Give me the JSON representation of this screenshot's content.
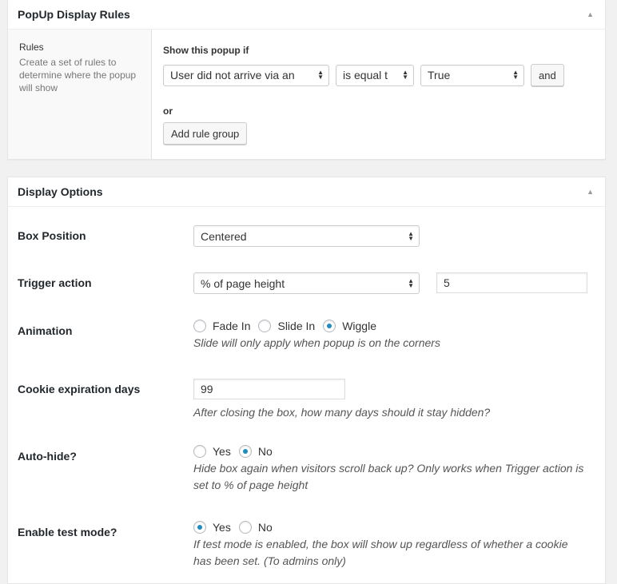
{
  "popup_rules": {
    "title": "PopUp Display Rules",
    "side_label": "Rules",
    "side_description": "Create a set of rules to determine where the popup will show",
    "show_if_label": "Show this popup if",
    "param_value": "User did not arrive via an",
    "operator_value": "is equal t",
    "value_value": "True",
    "and_label": "and",
    "or_label": "or",
    "add_group_label": "Add rule group"
  },
  "display_options": {
    "title": "Display Options",
    "box_position": {
      "label": "Box Position",
      "value": "Centered"
    },
    "trigger_action": {
      "label": "Trigger action",
      "value": "% of page height",
      "amount": "5"
    },
    "animation": {
      "label": "Animation",
      "options": [
        "Fade In",
        "Slide In",
        "Wiggle"
      ],
      "selected": "Wiggle",
      "hint": "Slide will only apply when popup is on the corners"
    },
    "cookie_expiration": {
      "label": "Cookie expiration days",
      "value": "99",
      "hint": "After closing the box, how many days should it stay hidden?"
    },
    "auto_hide": {
      "label": "Auto-hide?",
      "options": [
        "Yes",
        "No"
      ],
      "selected": "No",
      "hint_line1": "Hide box again when visitors scroll back up? Only works when Trigger action is",
      "hint_line2": "set to % of page height"
    },
    "test_mode": {
      "label": "Enable test mode?",
      "options": [
        "Yes",
        "No"
      ],
      "selected": "Yes",
      "hint_line1": "If test mode is enabled, the box will show up regardless of whether a cookie",
      "hint_line2": "has been set. (To admins only)"
    }
  },
  "colors": {
    "radio_selected": "#1e8cbe",
    "panel_bg": "#ffffff",
    "page_bg": "#f1f1f1"
  },
  "icons": {
    "collapse": "triangle-up-icon",
    "select_arrows": "updown-arrows-icon"
  }
}
